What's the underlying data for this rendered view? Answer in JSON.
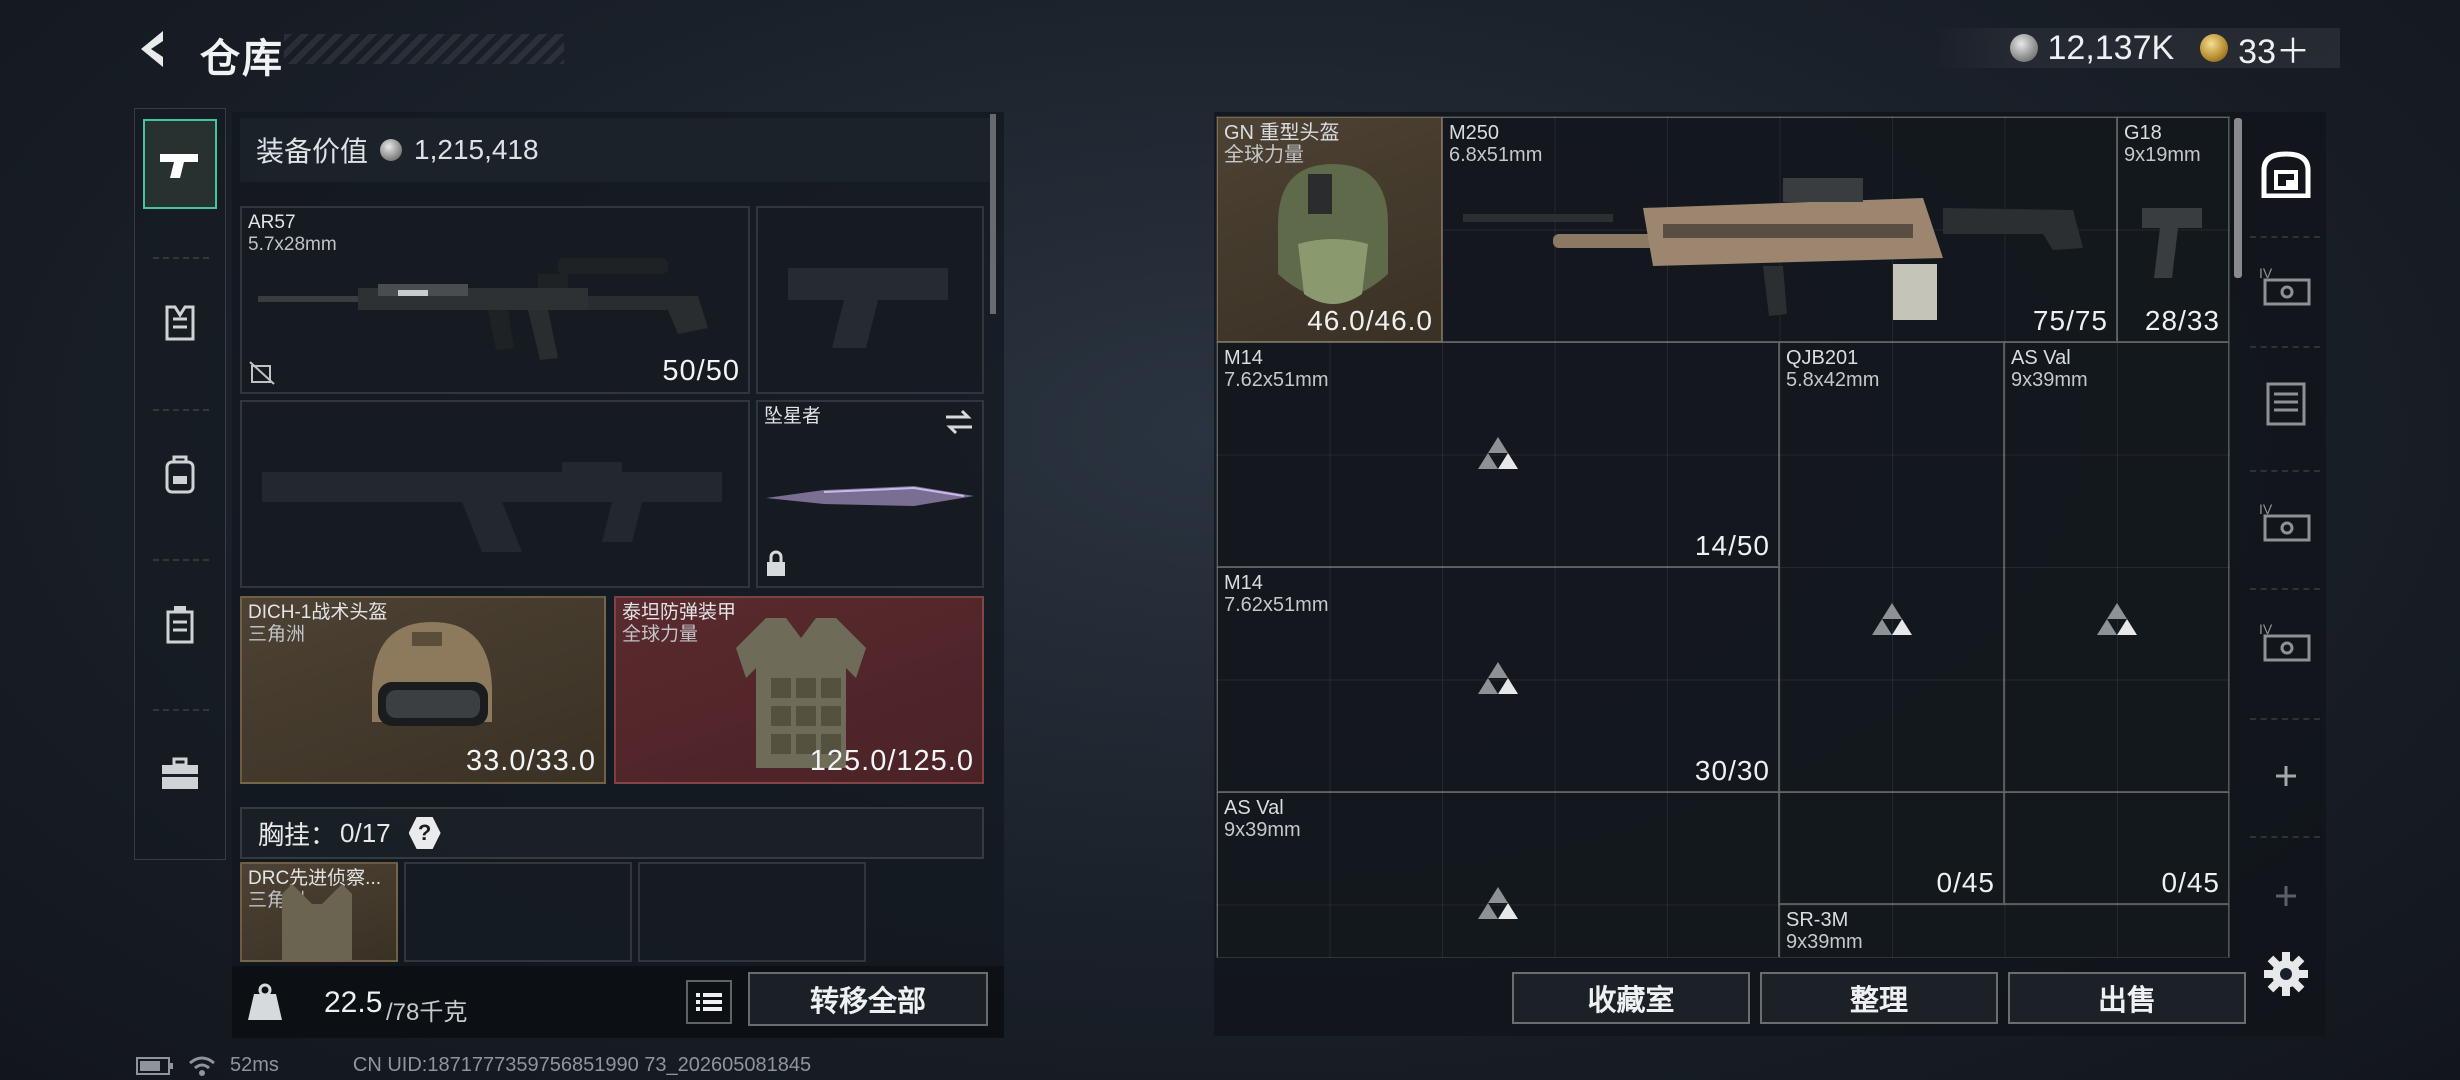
{
  "header": {
    "title": "仓库",
    "silver_amount": "12,137K",
    "gold_amount": "33＋"
  },
  "left": {
    "equip_value_label": "装备价值",
    "equip_value": "1,215,418",
    "primary_weapon": {
      "name": "AR57",
      "ammo": "5.7x28mm",
      "count": "50/50"
    },
    "melee": {
      "name": "坠星者"
    },
    "helmet": {
      "name": "DICH-1战术头盔",
      "region": "三角洲",
      "count": "33.0/33.0"
    },
    "armor": {
      "name": "泰坦防弹装甲",
      "region": "全球力量",
      "count": "125.0/125.0"
    },
    "chest_rig": {
      "label": "胸挂：",
      "count": "0/17",
      "help": "?"
    },
    "rig_item": {
      "name": "DRC先进侦察...",
      "region": "三角洲"
    },
    "weight_value": "22.5",
    "weight_max": "/78千克",
    "transfer_all": "转移全部"
  },
  "grid": {
    "items": [
      {
        "name": "GN 重型头盔",
        "sub": "全球力量",
        "count": "46.0/46.0"
      },
      {
        "name": "M250",
        "sub": "6.8x51mm",
        "count": "75/75"
      },
      {
        "name": "G18",
        "sub": "9x19mm",
        "count": "28/33"
      },
      {
        "name": "M14",
        "sub": "7.62x51mm",
        "count": "14/50"
      },
      {
        "name": "QJB201",
        "sub": "5.8x42mm",
        "count": ""
      },
      {
        "name": "AS Val",
        "sub": "9x39mm",
        "count": ""
      },
      {
        "name": "M14",
        "sub": "7.62x51mm",
        "count": "30/30"
      },
      {
        "name": "AS Val",
        "sub": "9x39mm",
        "count": ""
      },
      {
        "name": "",
        "sub": "",
        "count": "0/45"
      },
      {
        "name": "",
        "sub": "",
        "count": "0/45"
      },
      {
        "name": "SR-3M",
        "sub": "9x39mm",
        "count": ""
      }
    ]
  },
  "bottom_buttons": {
    "collection": "收藏室",
    "sort": "整理",
    "sell": "出售"
  },
  "status": {
    "ping": "52ms",
    "uid": "CN UID:1871777359756851990 73_202605081845"
  },
  "colors": {
    "accent": "#3fc6a1",
    "helmet_bg": "#4d4233",
    "armor_bg": "#5a2a2e"
  },
  "icons": {
    "nav": [
      "pistol-icon",
      "vest-icon",
      "backpack-icon",
      "rig-icon",
      "case-icon"
    ],
    "rail": [
      "stash-icon",
      "container-icon",
      "storage-icon",
      "container-icon",
      "container-icon",
      "plus-icon",
      "plus-icon",
      "gear-icon"
    ]
  }
}
